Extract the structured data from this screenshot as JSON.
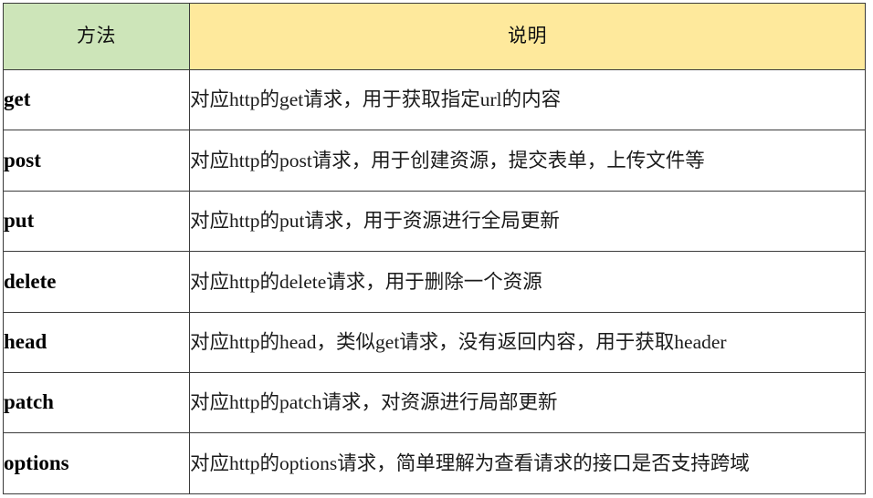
{
  "table": {
    "columns": [
      {
        "key": "method",
        "label": "方法",
        "header_bg": "#cde5b9"
      },
      {
        "key": "description",
        "label": "说明",
        "header_bg": "#fee99c"
      }
    ],
    "rows": [
      {
        "method": "get",
        "description": "对应http的get请求，用于获取指定url的内容"
      },
      {
        "method": "post",
        "description": "对应http的post请求，用于创建资源，提交表单，上传文件等"
      },
      {
        "method": "put",
        "description": "对应http的put请求，用于资源进行全局更新"
      },
      {
        "method": "delete",
        "description": "对应http的delete请求，用于删除一个资源"
      },
      {
        "method": "head",
        "description": "对应http的head，类似get请求，没有返回内容，用于获取header"
      },
      {
        "method": "patch",
        "description": "对应http的patch请求，对资源进行局部更新"
      },
      {
        "method": "options",
        "description": "对应http的options请求，简单理解为查看请求的接口是否支持跨域"
      }
    ]
  },
  "colors": {
    "header_method_bg": "#cde5b9",
    "header_desc_bg": "#fee99c",
    "border": "#3b3b3b",
    "body_bg": "#ffffff",
    "text": "#111111"
  }
}
